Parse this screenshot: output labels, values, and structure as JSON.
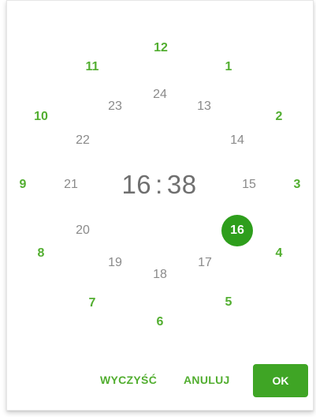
{
  "time": {
    "hours": "16",
    "separator": ":",
    "minutes": "38"
  },
  "outer_hours": [
    "12",
    "1",
    "2",
    "3",
    "4",
    "5",
    "6",
    "7",
    "8",
    "9",
    "10",
    "11"
  ],
  "inner_hours": [
    "24",
    "13",
    "14",
    "15",
    "16",
    "17",
    "18",
    "19",
    "20",
    "21",
    "22",
    "23"
  ],
  "selected_hour": "16",
  "actions": {
    "clear": "WYCZYŚĆ",
    "cancel": "ANULUJ",
    "ok": "OK"
  },
  "colors": {
    "accent": "#52ae30",
    "selected": "#2e9e1c",
    "ok_button": "#3fa525"
  }
}
